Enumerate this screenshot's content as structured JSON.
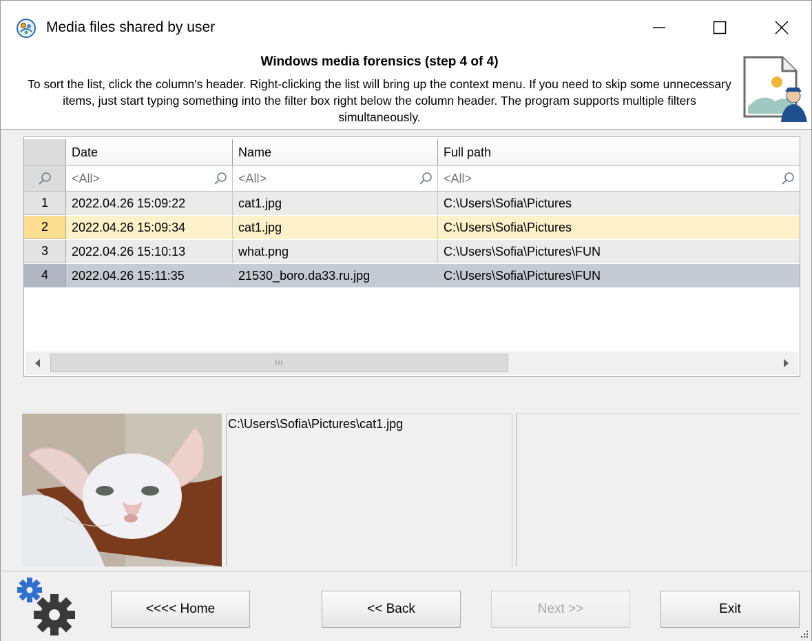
{
  "window": {
    "title": "Media files shared by user",
    "controls": {
      "minimize": "minimize-icon",
      "maximize": "maximize-icon",
      "close": "close-icon"
    }
  },
  "header": {
    "title": "Windows media forensics (step 4 of 4)",
    "description": "To sort the list, click the column's header. Right-clicking the list will bring up the context menu. If you need to skip some unnecessary items, just start typing something into the filter box right below the column header. The program supports multiple filters simultaneously."
  },
  "grid": {
    "columns": [
      "Date",
      "Name",
      "Full path"
    ],
    "filter_placeholder": "<All>",
    "filters": [
      "<All>",
      "<All>",
      "<All>"
    ],
    "rows": [
      {
        "num": "1",
        "date": "2022.04.26 15:09:22",
        "name": "cat1.jpg",
        "path": "C:\\Users\\Sofia\\Pictures"
      },
      {
        "num": "2",
        "date": "2022.04.26 15:09:34",
        "name": "cat1.jpg",
        "path": "C:\\Users\\Sofia\\Pictures"
      },
      {
        "num": "3",
        "date": "2022.04.26 15:10:13",
        "name": "what.png",
        "path": "C:\\Users\\Sofia\\Pictures\\FUN"
      },
      {
        "num": "4",
        "date": "2022.04.26 15:11:35",
        "name": "21530_boro.da33.ru.jpg",
        "path": "C:\\Users\\Sofia\\Pictures\\FUN"
      }
    ],
    "highlighted_row": 2,
    "selected_row": 4,
    "scrollbar_thumb_grip": "III"
  },
  "preview": {
    "file_path": "C:\\Users\\Sofia\\Pictures\\cat1.jpg"
  },
  "footer": {
    "home_label": "<<<< Home",
    "back_label": "<< Back",
    "next_label": "Next >>",
    "exit_label": "Exit",
    "next_enabled": false
  },
  "colors": {
    "highlight_row": "#fdf1c9",
    "selected_row": "#c6cad2",
    "gear_blue": "#2f6fd0",
    "gear_dark": "#3a3a3a"
  }
}
